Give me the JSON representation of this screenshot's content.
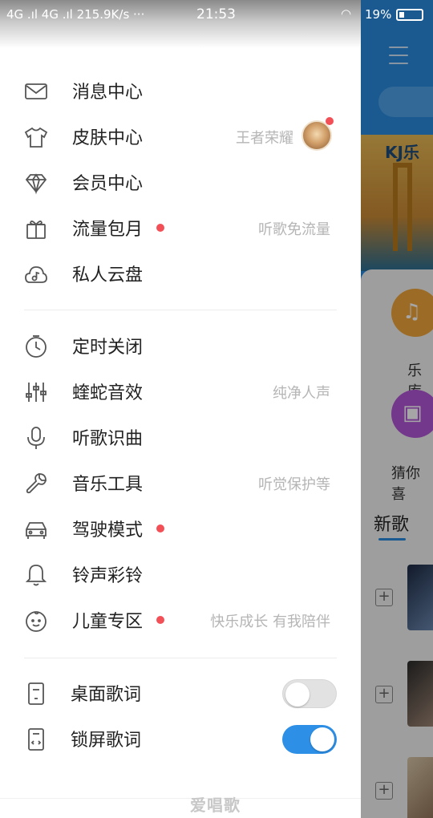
{
  "status_bar": {
    "network": "4G .ıl  4G .ıl  215.9K/s  ···",
    "time": "21:53",
    "battery": "19%"
  },
  "menu": {
    "group1": [
      {
        "label": "消息中心",
        "hint": "",
        "dot": false,
        "icon": "envelope-icon"
      },
      {
        "label": "皮肤中心",
        "hint": "王者荣耀",
        "dot": false,
        "icon": "shirt-icon"
      },
      {
        "label": "会员中心",
        "hint": "",
        "dot": false,
        "icon": "diamond-icon"
      },
      {
        "label": "流量包月",
        "hint": "听歌免流量",
        "dot": true,
        "icon": "gift-icon"
      },
      {
        "label": "私人云盘",
        "hint": "",
        "dot": false,
        "icon": "cloud-music-icon"
      }
    ],
    "group2": [
      {
        "label": "定时关闭",
        "hint": "",
        "dot": false,
        "icon": "clock-icon"
      },
      {
        "label": "蝰蛇音效",
        "hint": "纯净人声",
        "dot": false,
        "icon": "equalizer-icon"
      },
      {
        "label": "听歌识曲",
        "hint": "",
        "dot": false,
        "icon": "microphone-icon"
      },
      {
        "label": "音乐工具",
        "hint": "听觉保护等",
        "dot": false,
        "icon": "wrench-icon"
      },
      {
        "label": "驾驶模式",
        "hint": "",
        "dot": true,
        "icon": "car-icon"
      },
      {
        "label": "铃声彩铃",
        "hint": "",
        "dot": false,
        "icon": "bell-icon"
      },
      {
        "label": "儿童专区",
        "hint": "快乐成长 有我陪伴",
        "dot": true,
        "icon": "baby-icon"
      }
    ],
    "group3": [
      {
        "label": "桌面歌词",
        "toggle": "off",
        "icon": "desktop-lyrics-icon"
      },
      {
        "label": "锁屏歌词",
        "toggle": "on",
        "icon": "lockscreen-lyrics-icon"
      }
    ]
  },
  "background": {
    "banner_text": "KJ乐",
    "item1_label": "乐库",
    "item2_label": "猜你喜",
    "new_songs_tab": "新歌"
  },
  "watermark": "爱唱歌",
  "colors": {
    "accent": "#2d8fe6",
    "badge": "#f24f57",
    "hint_text": "#b5b5b5",
    "bg_app": "#2a8bdf"
  }
}
